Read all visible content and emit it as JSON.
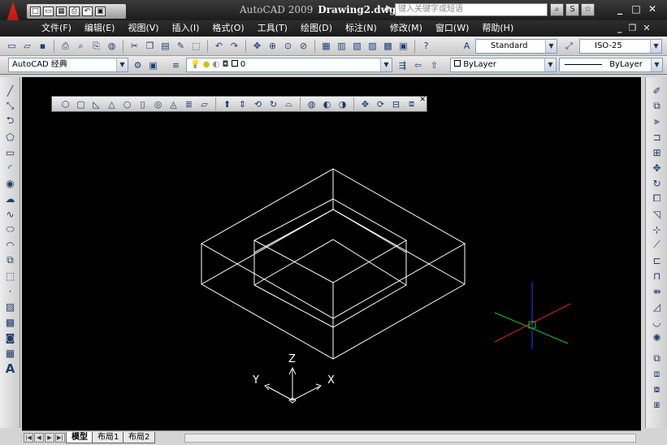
{
  "window": {
    "app_name": "AutoCAD 2009",
    "document": "Drawing2.dwg",
    "search_placeholder": "键入关键字或短语",
    "search_tools": [
      "⌕",
      "S",
      "☆"
    ],
    "controls": [
      "_",
      "□",
      "✕"
    ],
    "mdi_controls": [
      "_",
      "❐",
      "✕"
    ]
  },
  "quick_access": [
    "□",
    "▭",
    "▦",
    "⎙",
    "↶",
    "▣"
  ],
  "menu": [
    "文件(F)",
    "编辑(E)",
    "视图(V)",
    "插入(I)",
    "格式(O)",
    "工具(T)",
    "绘图(D)",
    "标注(N)",
    "修改(M)",
    "窗口(W)",
    "帮助(H)"
  ],
  "toolbar_standard": {
    "text_style": "Standard",
    "dim_style": "ISO-25"
  },
  "toolbar_workspace": {
    "workspace": "AutoCAD 经典",
    "layer": "0",
    "color": "ByLayer",
    "linetype": "ByLayer"
  },
  "layout_tabs": [
    {
      "label": "模型",
      "active": true
    },
    {
      "label": "布局1",
      "active": false
    },
    {
      "label": "布局2",
      "active": false
    }
  ],
  "ucs": {
    "x": "X",
    "y": "Y",
    "z": "Z"
  },
  "colors": {
    "canvas": "#000000",
    "title_bar": "#1c1c1c",
    "wireframe": "#ffffff",
    "cursor_x": "#e02020",
    "cursor_y": "#20c020",
    "cursor_z": "#2040ff"
  },
  "floating_toolbar_icons": [
    "box-icon",
    "wedge-icon",
    "cone-icon",
    "sphere-icon",
    "cylinder-icon",
    "torus-icon",
    "pyramid-icon",
    "helix-icon",
    "planar-surface-icon",
    "extrude-icon",
    "presspull-icon",
    "sweep-icon",
    "revolve-icon",
    "loft-icon",
    "union-icon",
    "subtract-icon",
    "intersect-icon",
    "3d-move-icon",
    "3d-rotate-icon",
    "section-plane-icon",
    "flatshot-icon"
  ]
}
